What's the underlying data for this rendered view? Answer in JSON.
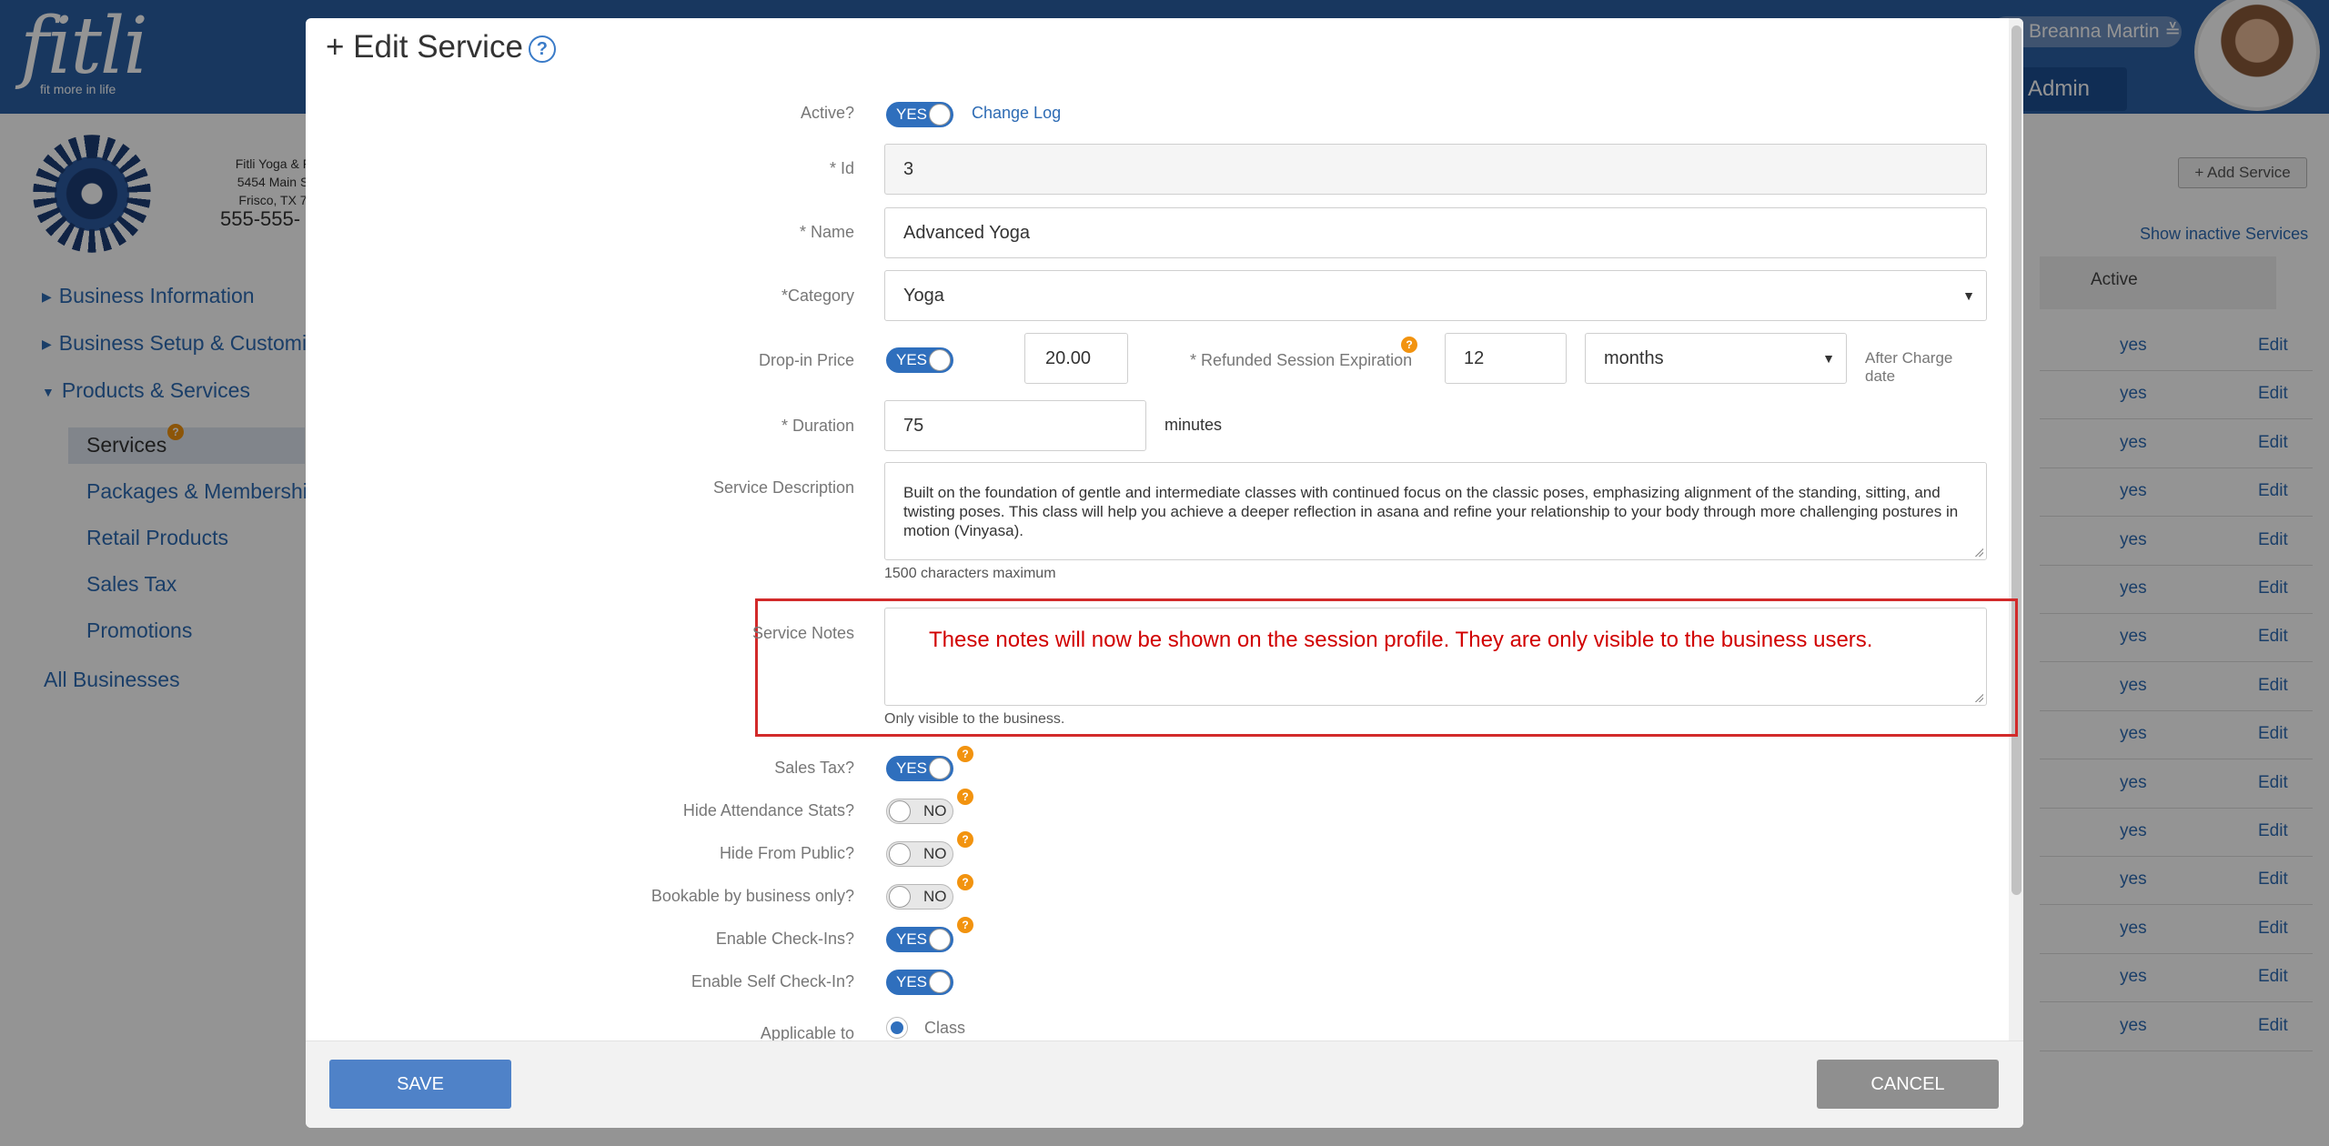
{
  "app": {
    "logo_word": "fitli",
    "logo_tagline": "fit more in life",
    "user_name": "Breanna Martin",
    "user_menu_icon": "chevron-double-down-icon",
    "admin_label": "Admin"
  },
  "business": {
    "name": "Fitli Yoga & F",
    "address1": "5454 Main S",
    "address2": "Frisco, TX 7",
    "phone": "555-555-"
  },
  "sidebar": {
    "items": [
      {
        "label": "Business Information"
      },
      {
        "label": "Business Setup & Customiza"
      },
      {
        "label": "Products & Services"
      },
      {
        "label": "Services",
        "badge": "?"
      },
      {
        "label": "Packages & Memberships"
      },
      {
        "label": "Retail Products"
      },
      {
        "label": "Sales Tax"
      },
      {
        "label": "Promotions"
      },
      {
        "label": "All Businesses"
      }
    ]
  },
  "services_page": {
    "add_button": "+ Add Service",
    "show_inactive": "Show inactive Services",
    "col_active": "Active",
    "rows": [
      {
        "active": "yes",
        "action": "Edit"
      },
      {
        "active": "yes",
        "action": "Edit"
      },
      {
        "active": "yes",
        "action": "Edit"
      },
      {
        "active": "yes",
        "action": "Edit"
      },
      {
        "active": "yes",
        "action": "Edit"
      },
      {
        "active": "yes",
        "action": "Edit"
      },
      {
        "active": "yes",
        "action": "Edit"
      },
      {
        "active": "yes",
        "action": "Edit"
      },
      {
        "active": "yes",
        "action": "Edit"
      },
      {
        "active": "yes",
        "action": "Edit"
      },
      {
        "active": "yes",
        "action": "Edit"
      },
      {
        "active": "yes",
        "action": "Edit"
      },
      {
        "active": "yes",
        "action": "Edit"
      },
      {
        "active": "yes",
        "action": "Edit"
      },
      {
        "active": "yes",
        "action": "Edit"
      }
    ]
  },
  "modal": {
    "title": "+ Edit Service",
    "help": "?",
    "active": {
      "label": "Active?",
      "value": "YES",
      "change_log": "Change Log"
    },
    "id": {
      "label": "* Id",
      "value": "3"
    },
    "name": {
      "label": "* Name",
      "value": "Advanced Yoga"
    },
    "category": {
      "label": "*Category",
      "value": "Yoga"
    },
    "drop_in": {
      "label": "Drop-in Price",
      "toggle": "YES",
      "price": "20.00"
    },
    "refund": {
      "label": "* Refunded Session Expiration",
      "value": "12",
      "unit": "months",
      "after_charge": "After Charge date"
    },
    "duration": {
      "label": "* Duration",
      "value": "75",
      "unit": "minutes"
    },
    "description": {
      "label": "Service Description",
      "value": "Built on the foundation of gentle and intermediate classes with continued focus on the classic poses, emphasizing alignment of the standing, sitting, and twisting poses. This class will help you achieve a deeper reflection in asana and refine your relationship to your body through more challenging postures in motion (Vinyasa).",
      "hint": "1500 characters maximum"
    },
    "notes": {
      "label": "Service Notes",
      "value": "These notes will now be shown on the session profile.  They are only visible to the business users.",
      "hint": "Only visible to the business."
    },
    "toggles": [
      {
        "label": "Sales Tax?",
        "value": "YES"
      },
      {
        "label": "Hide Attendance Stats?",
        "value": "NO"
      },
      {
        "label": "Hide From Public?",
        "value": "NO"
      },
      {
        "label": "Bookable by business only?",
        "value": "NO"
      },
      {
        "label": "Enable Check-Ins?",
        "value": "YES"
      },
      {
        "label": "Enable Self Check-In?",
        "value": "YES"
      }
    ],
    "applicable": {
      "label": "Applicable to",
      "option": "Class"
    },
    "badge": "?",
    "save": "SAVE",
    "cancel": "CANCEL"
  }
}
